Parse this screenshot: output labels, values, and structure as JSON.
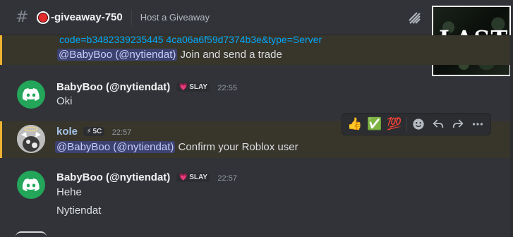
{
  "header": {
    "channel_name": "-giveaway-750",
    "topic": "Host a Giveaway"
  },
  "corner_image": {
    "label": "LAST"
  },
  "messages": {
    "partial_link": "code=b3482339235445 4ca06a6f59d7374b3e&type=Server",
    "reply1": {
      "mention": "@BabyBoo (@nytiendat)",
      "text": "Join and send a trade"
    },
    "msg1": {
      "username": "BabyBoo (@nytiendat)",
      "badge": "SLAY",
      "time": "22:55",
      "text": "Oki"
    },
    "msg2": {
      "username": "kole",
      "badge": "5C",
      "time": "22:57",
      "mention": "@BabyBoo (@nytiendat)",
      "text": "Confirm your Roblox user"
    },
    "msg3": {
      "username": "BabyBoo (@nytiendat)",
      "badge": "SLAY",
      "time": "22:57",
      "lines": [
        "Hehe",
        "Nytiendat"
      ]
    }
  },
  "toolbar": {
    "reactions": [
      "👍",
      "✅",
      "💯"
    ],
    "icons": [
      "add-reaction-icon",
      "reply-icon",
      "forward-icon",
      "more-icon"
    ]
  },
  "colors": {
    "background": "#313338",
    "mention_highlight": "#38352b",
    "mention_bar": "#f0b232",
    "discord_green": "#23a55a",
    "link": "#00a8fc"
  }
}
